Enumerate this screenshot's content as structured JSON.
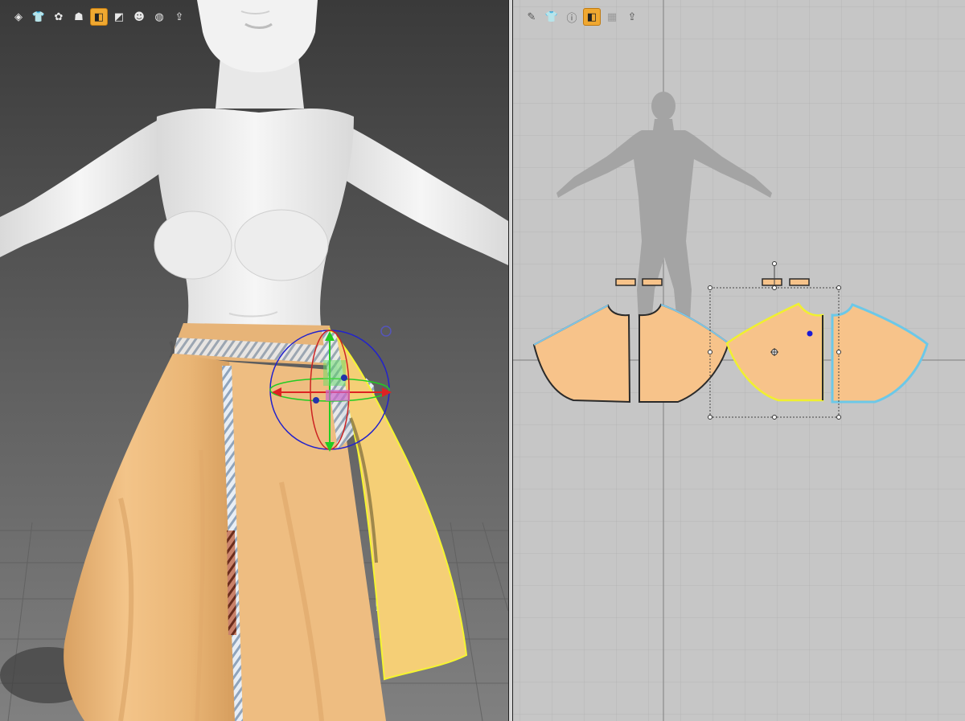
{
  "viewport_3d": {
    "toolbar": [
      {
        "name": "avatar-display-icon",
        "glyph": "◈",
        "active": false
      },
      {
        "name": "garment-display-icon",
        "glyph": "👕",
        "active": false
      },
      {
        "name": "fabric-render-icon",
        "glyph": "✿",
        "active": false
      },
      {
        "name": "avatar-pose-icon",
        "glyph": "☗",
        "active": false
      },
      {
        "name": "pattern-display-icon",
        "glyph": "◧",
        "active": true
      },
      {
        "name": "texture-surface-icon",
        "glyph": "◩",
        "active": false
      },
      {
        "name": "skin-display-icon",
        "glyph": "☻",
        "active": false
      },
      {
        "name": "world-display-icon",
        "glyph": "◍",
        "active": false
      },
      {
        "name": "export-icon",
        "glyph": "⇪",
        "active": false
      }
    ],
    "colors": {
      "fabric": "#f2c48a",
      "fabric_selected": "#f5cf76",
      "selection_outline": "#f5f530",
      "avatar": "#f0f0f0"
    }
  },
  "viewport_2d": {
    "toolbar": [
      {
        "name": "pattern-edit-icon",
        "glyph": "✎",
        "active": false,
        "disabled": false
      },
      {
        "name": "avatar-silhouette-icon",
        "glyph": "👕",
        "active": false,
        "disabled": false
      },
      {
        "name": "info-icon",
        "glyph": "ⓘ",
        "active": false,
        "disabled": false
      },
      {
        "name": "pattern-fill-icon",
        "glyph": "◧",
        "active": true,
        "disabled": false
      },
      {
        "name": "texture-icon",
        "glyph": "▦",
        "active": false,
        "disabled": true
      },
      {
        "name": "export-2d-icon",
        "glyph": "⇪",
        "active": false,
        "disabled": false
      }
    ],
    "colors": {
      "pattern_fill": "#f7c38a",
      "pattern_outline": "#7fc6e6",
      "selected_outline": "#f0f030",
      "grid": "#b4b4b4"
    }
  }
}
